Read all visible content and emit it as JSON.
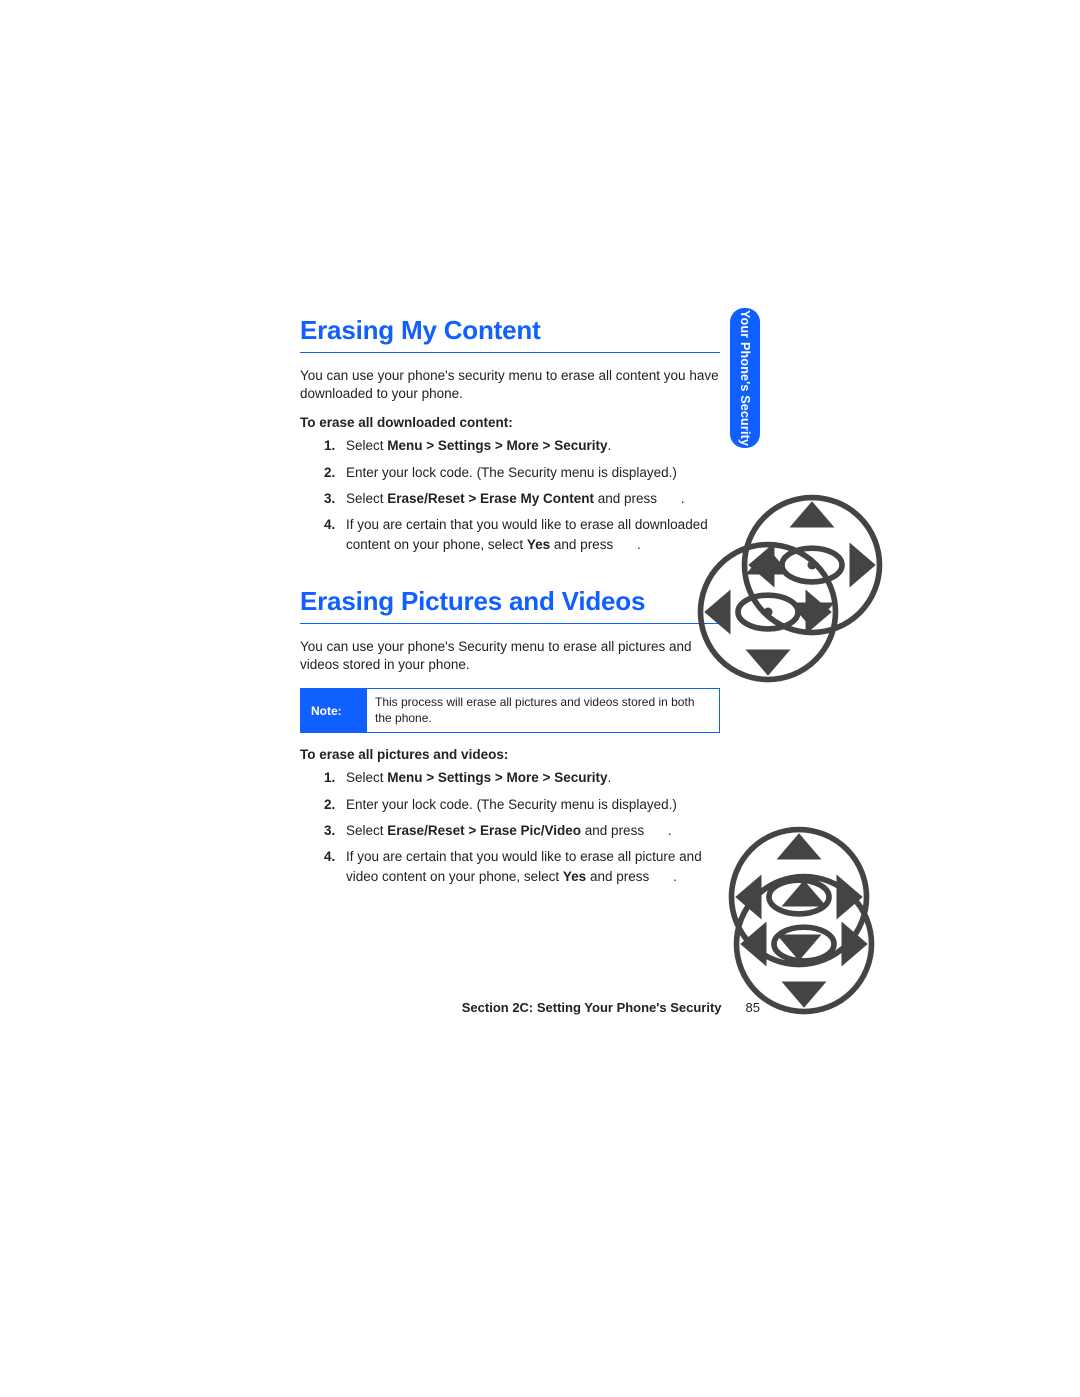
{
  "sideTab": "Your Phone's Security",
  "section1": {
    "heading": "Erasing My Content",
    "intro": "You can use your phone's security menu to erase all content you have downloaded to your phone.",
    "lead": "To erase all downloaded content:",
    "steps": {
      "n1": "1.",
      "s1a": "Select ",
      "s1b": "Menu > Settings > More > Security",
      "s1c": ".",
      "n2": "2.",
      "s2": "Enter your lock code. (The Security menu is displayed.)",
      "n3": "3.",
      "s3a": "Select ",
      "s3b": "Erase/Reset > Erase My Content",
      "s3c": " and press ",
      "s3d": ".",
      "n4": "4.",
      "s4a": "If you are certain that you would like to erase all downloaded content on your phone, select ",
      "s4b": "Yes",
      "s4c": " and press ",
      "s4d": "."
    }
  },
  "section2": {
    "heading": "Erasing Pictures and Videos",
    "intro": "You can use your phone's Security menu to erase all pictures and videos stored in your phone.",
    "note": {
      "label": "Note:",
      "text": "This process will erase all pictures and videos stored in both the phone."
    },
    "lead": "To erase all pictures and videos:",
    "steps": {
      "n1": "1.",
      "s1a": "Select ",
      "s1b": "Menu > Settings > More > Security",
      "s1c": ".",
      "n2": "2.",
      "s2": "Enter your lock code. (The Security menu is displayed.)",
      "n3": "3.",
      "s3a": "Select ",
      "s3b": "Erase/Reset > Erase Pic/Video",
      "s3c": " and press ",
      "s3d": ".",
      "n4": "4.",
      "s4a": "If you are certain that you would like to erase all picture and video content on your phone, select ",
      "s4b": "Yes",
      "s4c": " and press ",
      "s4d": "."
    }
  },
  "footer": {
    "title": "Section 2C: Setting Your Phone's Security",
    "page": "85"
  }
}
